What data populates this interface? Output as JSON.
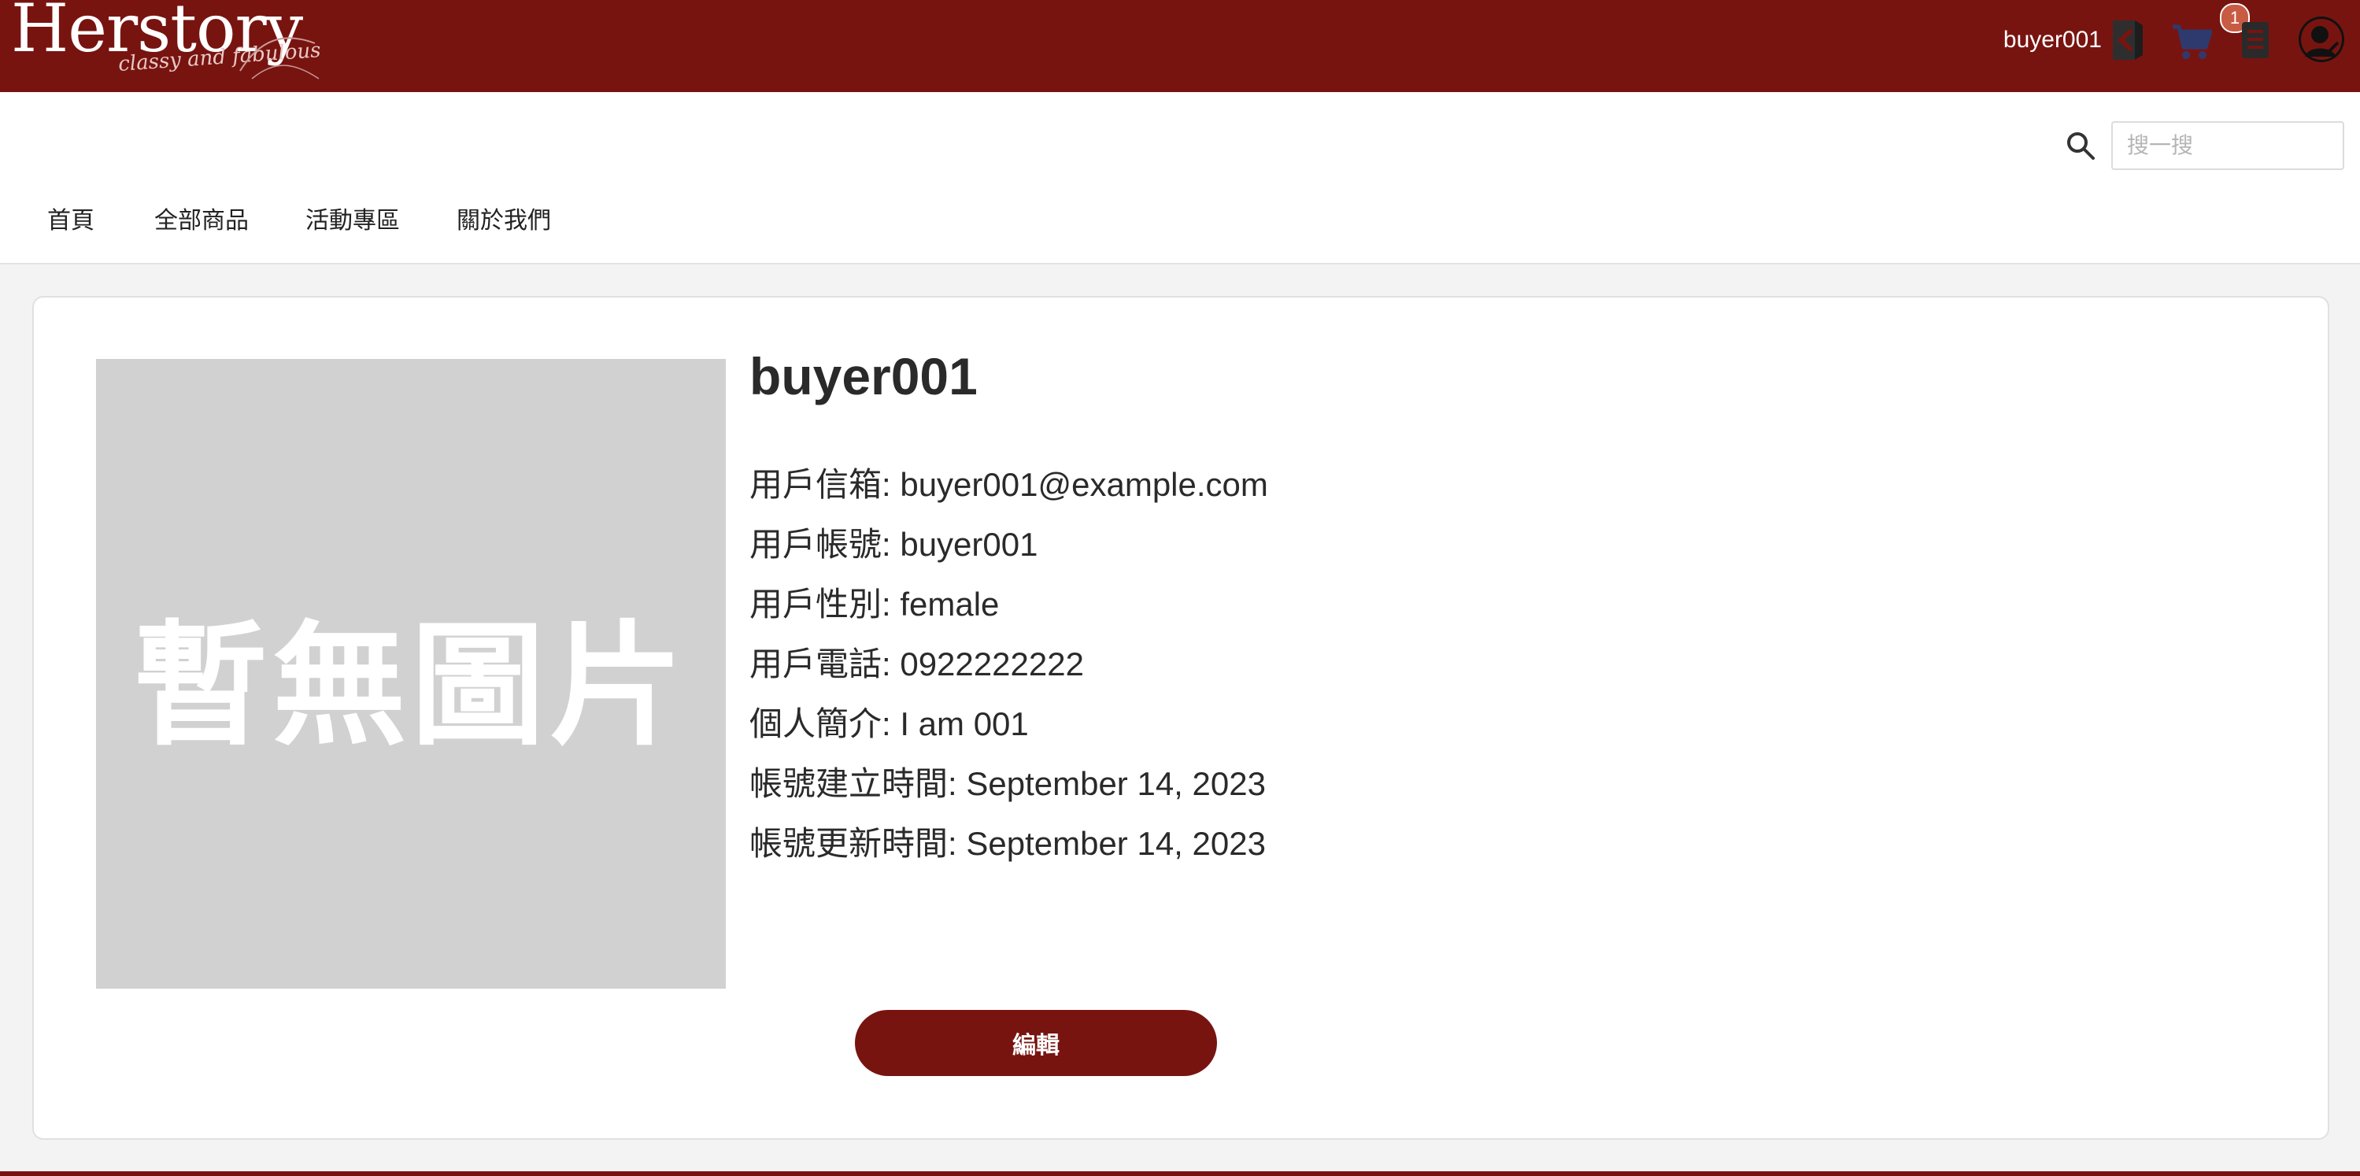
{
  "header": {
    "logo_text": "Herstory",
    "logo_tagline": "classy and fabulous",
    "username": "buyer001",
    "cart_count": "1",
    "icons": [
      "logout-icon",
      "cart-icon",
      "orders-icon",
      "avatar-icon"
    ],
    "brand_color": "#781410"
  },
  "nav": {
    "items": [
      {
        "label": "首頁"
      },
      {
        "label": "全部商品"
      },
      {
        "label": "活動專區"
      },
      {
        "label": "關於我們"
      }
    ],
    "search_placeholder": "搜一搜"
  },
  "profile": {
    "photo_placeholder": "暫無圖片",
    "name": "buyer001",
    "fields": [
      {
        "text": "用戶信箱: buyer001@example.com"
      },
      {
        "text": "用戶帳號: buyer001"
      },
      {
        "text": "用戶性別: female"
      },
      {
        "text": "用戶電話: 0922222222"
      },
      {
        "text": "個人簡介: I am 001"
      },
      {
        "text": "帳號建立時間: September 14, 2023"
      },
      {
        "text": "帳號更新時間: September 14, 2023"
      }
    ],
    "edit_label": "編輯"
  }
}
